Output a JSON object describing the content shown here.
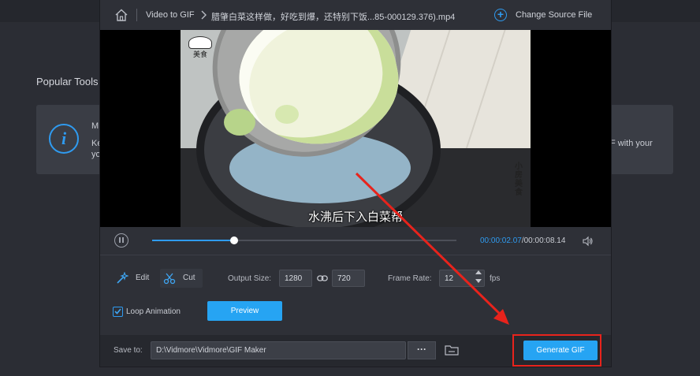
{
  "background": {
    "heading": "Popular Tools",
    "card_line1": "M",
    "card_line2": "Ke",
    "card_line3": "yo",
    "card_right": "F with your",
    "info_icon": "info-icon"
  },
  "header": {
    "home_icon": "home-icon",
    "breadcrumb_tool": "Video to GIF",
    "breadcrumb_file": "腊肇白菜这样做，好吃到爆，还特别下饭...85-000129.376).mp4",
    "change_source_label": "Change Source File"
  },
  "video": {
    "logo_text": "美食",
    "watermark_text": "小房美食",
    "subtitle": "水沸后下入白菜帮"
  },
  "player": {
    "current_time": "00:00:02.07",
    "total_time": "/00:00:08.14",
    "progress": 0.27
  },
  "tools": {
    "edit_label": "Edit",
    "cut_label": "Cut",
    "output_size_label": "Output Size:",
    "width": "1280",
    "height": "720",
    "frame_rate_label": "Frame Rate:",
    "frame_rate": "12",
    "fps_label": "fps",
    "loop_label": "Loop Animation",
    "loop_checked": true,
    "preview_label": "Preview"
  },
  "footer": {
    "save_to_label": "Save to:",
    "save_path": "D:\\Vidmore\\Vidmore\\GIF Maker",
    "more_label": "···",
    "generate_label": "Generate GIF"
  },
  "colors": {
    "accent": "#26a4f3",
    "highlight": "#e8231c"
  }
}
